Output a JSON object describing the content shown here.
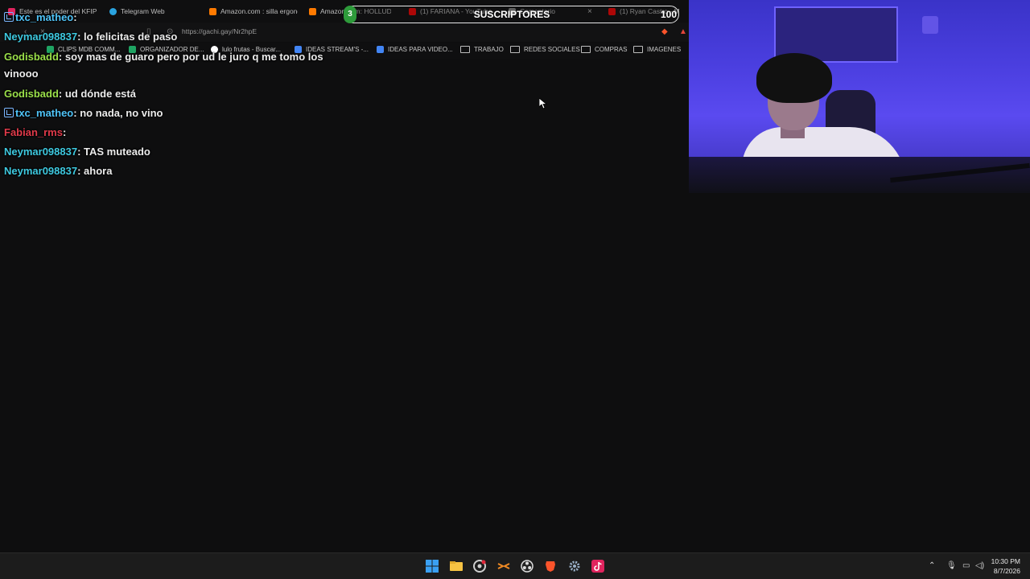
{
  "browser": {
    "tabs": [
      {
        "label": "Este es el poder del KFIP",
        "color": "#e0245e"
      },
      {
        "label": "Telegram Web",
        "color": "#2aa3e0"
      },
      {
        "label": "Amazon.com : silla ergonó",
        "color": "#ff7a00"
      },
      {
        "label": "Amazon.com: HOLLUDLE",
        "color": "#ff7a00"
      },
      {
        "label": "(1) FARIANA - YouTube",
        "color": "#ff0000"
      },
      {
        "label": "Comentario",
        "color": "#888888"
      },
      {
        "label": "(1) Ryan Castro - M",
        "color": "#ff0000"
      }
    ],
    "url": "https://gachi.gay/Nr2hpE",
    "bookmarks": [
      {
        "label": "CLIPS MDB COMM...",
        "type": "sheet"
      },
      {
        "label": "ORGANIZADOR DE...",
        "type": "sheet"
      },
      {
        "label": "lulo frutas - Buscar...",
        "type": "google"
      },
      {
        "label": "IDEAS STREAM'S -...",
        "type": "doc"
      },
      {
        "label": "IDEAS PARA VIDEO...",
        "type": "doc"
      },
      {
        "label": "TRABAJO",
        "type": "folder"
      },
      {
        "label": "REDES SOCIALES",
        "type": "folder"
      },
      {
        "label": "COMPRAS",
        "type": "folder"
      },
      {
        "label": "IMAGENES",
        "type": "folder"
      }
    ]
  },
  "overlay": {
    "title": "SUSCRIPTORES",
    "start": "3",
    "goal": "100"
  },
  "chat": [
    {
      "user": "txc_matheo",
      "color": "#4fc3f7",
      "badge": true,
      "text": ""
    },
    {
      "user": "Neymar098837",
      "color": "#3ec9e0",
      "badge": false,
      "text": "lo felicitas de paso"
    },
    {
      "user": "Godisbadd",
      "color": "#9be04a",
      "badge": false,
      "text": "soy mas de guaro pero por ud le juro q me tomo los vinooo"
    },
    {
      "user": "Godisbadd",
      "color": "#9be04a",
      "badge": false,
      "text": "ud dónde está"
    },
    {
      "user": "txc_matheo",
      "color": "#4fc3f7",
      "badge": true,
      "text": "no nada, no vino"
    },
    {
      "user": "Fabian_rms",
      "color": "#e03a4a",
      "badge": false,
      "text": ""
    },
    {
      "user": "Neymar098837",
      "color": "#3ec9e0",
      "badge": false,
      "text": "TAS muteado"
    },
    {
      "user": "Neymar098837",
      "color": "#3ec9e0",
      "badge": false,
      "text": "ahora"
    }
  ],
  "taskbar": {
    "apps": [
      "windows-start",
      "file-explorer",
      "chrome-canary",
      "streaming-tool",
      "obs",
      "brave",
      "settings",
      "tiktok-live"
    ],
    "time": "10:30 PM",
    "date": "8/7/2026"
  }
}
